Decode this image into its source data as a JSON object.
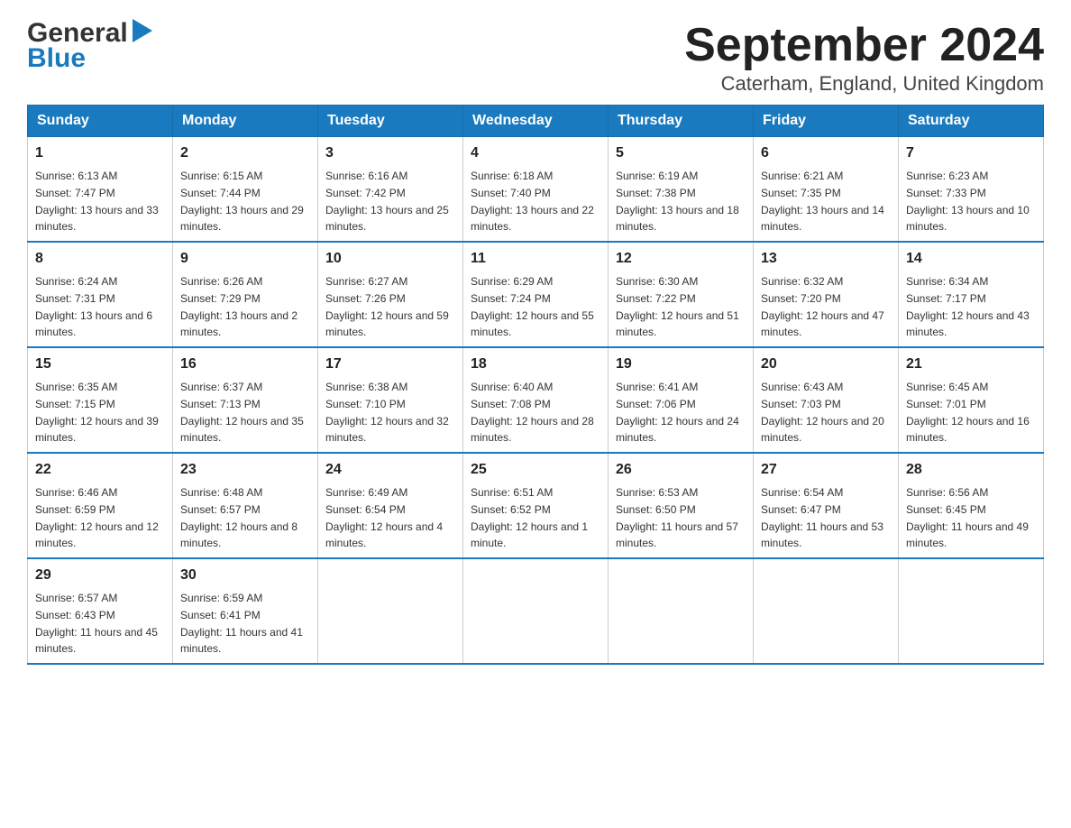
{
  "logo": {
    "general": "General",
    "blue": "Blue",
    "triangle": "▶"
  },
  "title": "September 2024",
  "subtitle": "Caterham, England, United Kingdom",
  "weekdays": [
    "Sunday",
    "Monday",
    "Tuesday",
    "Wednesday",
    "Thursday",
    "Friday",
    "Saturday"
  ],
  "weeks": [
    [
      {
        "day": "1",
        "sunrise": "6:13 AM",
        "sunset": "7:47 PM",
        "daylight": "13 hours and 33 minutes."
      },
      {
        "day": "2",
        "sunrise": "6:15 AM",
        "sunset": "7:44 PM",
        "daylight": "13 hours and 29 minutes."
      },
      {
        "day": "3",
        "sunrise": "6:16 AM",
        "sunset": "7:42 PM",
        "daylight": "13 hours and 25 minutes."
      },
      {
        "day": "4",
        "sunrise": "6:18 AM",
        "sunset": "7:40 PM",
        "daylight": "13 hours and 22 minutes."
      },
      {
        "day": "5",
        "sunrise": "6:19 AM",
        "sunset": "7:38 PM",
        "daylight": "13 hours and 18 minutes."
      },
      {
        "day": "6",
        "sunrise": "6:21 AM",
        "sunset": "7:35 PM",
        "daylight": "13 hours and 14 minutes."
      },
      {
        "day": "7",
        "sunrise": "6:23 AM",
        "sunset": "7:33 PM",
        "daylight": "13 hours and 10 minutes."
      }
    ],
    [
      {
        "day": "8",
        "sunrise": "6:24 AM",
        "sunset": "7:31 PM",
        "daylight": "13 hours and 6 minutes."
      },
      {
        "day": "9",
        "sunrise": "6:26 AM",
        "sunset": "7:29 PM",
        "daylight": "13 hours and 2 minutes."
      },
      {
        "day": "10",
        "sunrise": "6:27 AM",
        "sunset": "7:26 PM",
        "daylight": "12 hours and 59 minutes."
      },
      {
        "day": "11",
        "sunrise": "6:29 AM",
        "sunset": "7:24 PM",
        "daylight": "12 hours and 55 minutes."
      },
      {
        "day": "12",
        "sunrise": "6:30 AM",
        "sunset": "7:22 PM",
        "daylight": "12 hours and 51 minutes."
      },
      {
        "day": "13",
        "sunrise": "6:32 AM",
        "sunset": "7:20 PM",
        "daylight": "12 hours and 47 minutes."
      },
      {
        "day": "14",
        "sunrise": "6:34 AM",
        "sunset": "7:17 PM",
        "daylight": "12 hours and 43 minutes."
      }
    ],
    [
      {
        "day": "15",
        "sunrise": "6:35 AM",
        "sunset": "7:15 PM",
        "daylight": "12 hours and 39 minutes."
      },
      {
        "day": "16",
        "sunrise": "6:37 AM",
        "sunset": "7:13 PM",
        "daylight": "12 hours and 35 minutes."
      },
      {
        "day": "17",
        "sunrise": "6:38 AM",
        "sunset": "7:10 PM",
        "daylight": "12 hours and 32 minutes."
      },
      {
        "day": "18",
        "sunrise": "6:40 AM",
        "sunset": "7:08 PM",
        "daylight": "12 hours and 28 minutes."
      },
      {
        "day": "19",
        "sunrise": "6:41 AM",
        "sunset": "7:06 PM",
        "daylight": "12 hours and 24 minutes."
      },
      {
        "day": "20",
        "sunrise": "6:43 AM",
        "sunset": "7:03 PM",
        "daylight": "12 hours and 20 minutes."
      },
      {
        "day": "21",
        "sunrise": "6:45 AM",
        "sunset": "7:01 PM",
        "daylight": "12 hours and 16 minutes."
      }
    ],
    [
      {
        "day": "22",
        "sunrise": "6:46 AM",
        "sunset": "6:59 PM",
        "daylight": "12 hours and 12 minutes."
      },
      {
        "day": "23",
        "sunrise": "6:48 AM",
        "sunset": "6:57 PM",
        "daylight": "12 hours and 8 minutes."
      },
      {
        "day": "24",
        "sunrise": "6:49 AM",
        "sunset": "6:54 PM",
        "daylight": "12 hours and 4 minutes."
      },
      {
        "day": "25",
        "sunrise": "6:51 AM",
        "sunset": "6:52 PM",
        "daylight": "12 hours and 1 minute."
      },
      {
        "day": "26",
        "sunrise": "6:53 AM",
        "sunset": "6:50 PM",
        "daylight": "11 hours and 57 minutes."
      },
      {
        "day": "27",
        "sunrise": "6:54 AM",
        "sunset": "6:47 PM",
        "daylight": "11 hours and 53 minutes."
      },
      {
        "day": "28",
        "sunrise": "6:56 AM",
        "sunset": "6:45 PM",
        "daylight": "11 hours and 49 minutes."
      }
    ],
    [
      {
        "day": "29",
        "sunrise": "6:57 AM",
        "sunset": "6:43 PM",
        "daylight": "11 hours and 45 minutes."
      },
      {
        "day": "30",
        "sunrise": "6:59 AM",
        "sunset": "6:41 PM",
        "daylight": "11 hours and 41 minutes."
      },
      null,
      null,
      null,
      null,
      null
    ]
  ],
  "labels": {
    "sunrise": "Sunrise:",
    "sunset": "Sunset:",
    "daylight": "Daylight:"
  }
}
